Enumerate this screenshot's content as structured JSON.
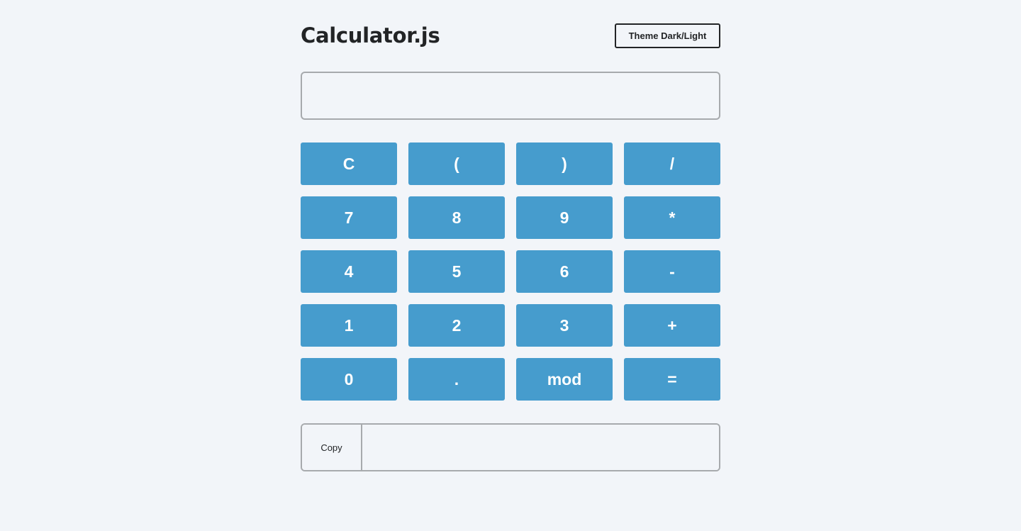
{
  "header": {
    "title": "Calculator.js",
    "theme_button_label": "Theme Dark/Light"
  },
  "display": {
    "value": "",
    "placeholder": ""
  },
  "keypad": {
    "keys": [
      "C",
      "(",
      ")",
      "/",
      "7",
      "8",
      "9",
      "*",
      "4",
      "5",
      "6",
      "-",
      "1",
      "2",
      "3",
      "+",
      "0",
      ".",
      "mod",
      "="
    ]
  },
  "result": {
    "copy_label": "Copy",
    "value": ""
  },
  "colors": {
    "background": "#f2f5f9",
    "key_accent": "#469ccd",
    "text": "#222426",
    "border": "#a7aaad"
  }
}
